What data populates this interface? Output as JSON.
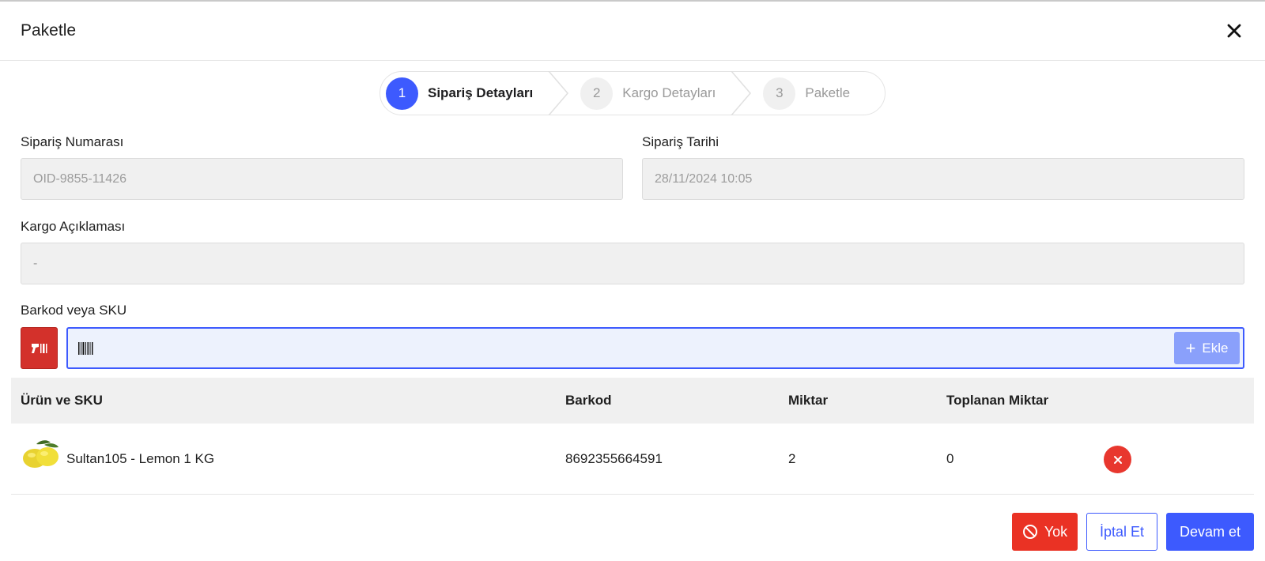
{
  "modal": {
    "title": "Paketle",
    "close_icon": "close-icon"
  },
  "stepper": {
    "steps": [
      {
        "number": "1",
        "label": "Sipariş Detayları",
        "state": "active"
      },
      {
        "number": "2",
        "label": "Kargo Detayları",
        "state": "inactive"
      },
      {
        "number": "3",
        "label": "Paketle",
        "state": "inactive"
      }
    ]
  },
  "form": {
    "order_number": {
      "label": "Sipariş Numarası",
      "value": "OID-9855-11426"
    },
    "order_date": {
      "label": "Sipariş Tarihi",
      "value": "28/11/2024 10:05"
    },
    "cargo_note": {
      "label": "Kargo Açıklaması",
      "value": "-"
    },
    "barcode": {
      "label": "Barkod veya SKU",
      "value": "",
      "add_label": "Ekle"
    }
  },
  "table": {
    "headers": [
      "Ürün ve SKU",
      "Barkod",
      "Miktar",
      "Toplanan Miktar"
    ],
    "rows": [
      {
        "product": "Sultan105 - Lemon 1 KG",
        "barcode": "8692355664591",
        "quantity": "2",
        "collected": "0"
      }
    ]
  },
  "footer": {
    "no_label": "Yok",
    "cancel_label": "İptal Et",
    "continue_label": "Devam et"
  },
  "colors": {
    "accent": "#3d5afe",
    "danger": "#ea3224",
    "muted_input": "#f0f0f0"
  }
}
